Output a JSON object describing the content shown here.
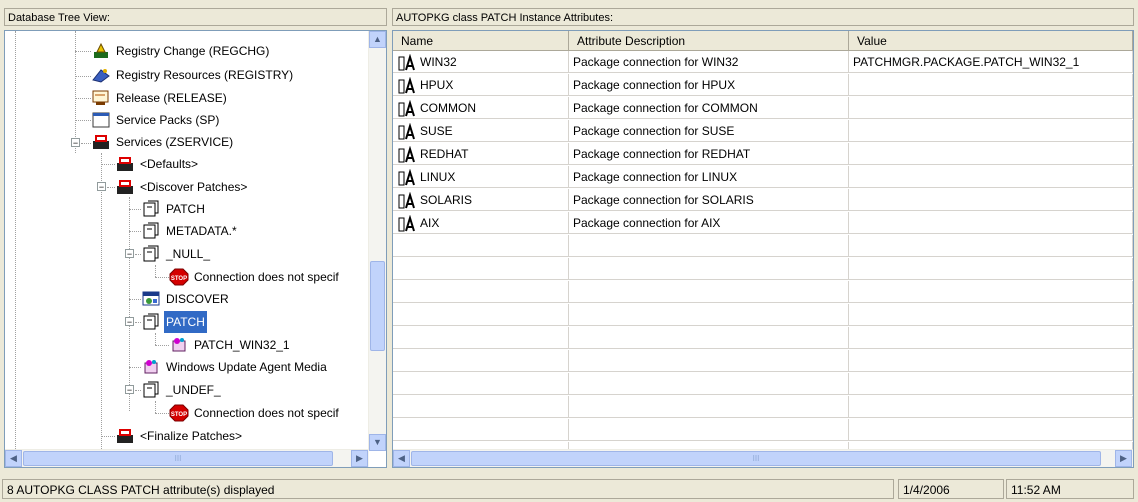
{
  "left_header": "Database Tree View:",
  "right_header": "AUTOPKG class PATCH Instance Attributes:",
  "tree": [
    {
      "label": "Registry Change (REGCHG)",
      "icon": "registry-change-icon"
    },
    {
      "label": "Registry Resources (REGISTRY)",
      "icon": "registry-resources-icon"
    },
    {
      "label": "Release (RELEASE)",
      "icon": "release-icon"
    },
    {
      "label": "Service Packs (SP)",
      "icon": "service-packs-icon"
    },
    {
      "label": "Services (ZSERVICE)",
      "icon": "services-icon"
    },
    {
      "label": "<Defaults>",
      "icon": "service-instance-icon"
    },
    {
      "label": "<Discover Patches>",
      "icon": "service-instance-icon"
    },
    {
      "label": "PATCH",
      "icon": "class-icon"
    },
    {
      "label": "METADATA.*",
      "icon": "class-icon"
    },
    {
      "label": "_NULL_",
      "icon": "class-icon"
    },
    {
      "label": "Connection does not specif",
      "icon": "stop-icon"
    },
    {
      "label": "DISCOVER",
      "icon": "discover-icon"
    },
    {
      "label": "PATCH",
      "icon": "class-icon"
    },
    {
      "label": "PATCH_WIN32_1",
      "icon": "package-icon"
    },
    {
      "label": "Windows Update Agent Media",
      "icon": "package-icon"
    },
    {
      "label": "_UNDEF_",
      "icon": "class-icon"
    },
    {
      "label": "Connection does not specif",
      "icon": "stop-icon"
    },
    {
      "label": "<Finalize Patches>",
      "icon": "service-instance-icon"
    }
  ],
  "table": {
    "columns": [
      "Name",
      "Attribute Description",
      "Value"
    ],
    "rows": [
      {
        "name": "WIN32",
        "description": "Package connection for WIN32",
        "value": "PATCHMGR.PACKAGE.PATCH_WIN32_1"
      },
      {
        "name": "HPUX",
        "description": "Package connection for HPUX",
        "value": ""
      },
      {
        "name": "COMMON",
        "description": "Package connection for COMMON",
        "value": ""
      },
      {
        "name": "SUSE",
        "description": "Package connection for SUSE",
        "value": ""
      },
      {
        "name": "REDHAT",
        "description": "Package connection for REDHAT",
        "value": ""
      },
      {
        "name": "LINUX",
        "description": "Package connection for LINUX",
        "value": ""
      },
      {
        "name": "SOLARIS",
        "description": "Package connection for SOLARIS",
        "value": ""
      },
      {
        "name": "AIX",
        "description": "Package connection for AIX",
        "value": ""
      }
    ]
  },
  "status": {
    "message": "8 AUTOPKG CLASS PATCH attribute(s) displayed",
    "date": "1/4/2006",
    "time": "11:52 AM"
  },
  "scroll": {
    "up_arrow": "▲",
    "down_arrow": "▼",
    "left_arrow": "◀",
    "right_arrow": "▶",
    "grip": "III"
  },
  "expander": {
    "collapse": "−"
  }
}
